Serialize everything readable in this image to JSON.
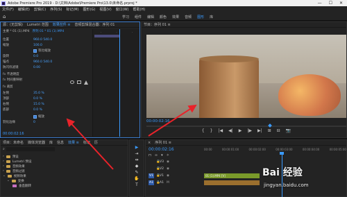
{
  "window": {
    "title": "Adobe Premiere Pro 2019 - D:\\文档\\Adobe\\Premiere Pro\\13.0\\未命名.prproj *",
    "minimize": "—",
    "maximize": "☐",
    "close": "✕"
  },
  "menu": [
    "文件(F)",
    "编辑(E)",
    "剪辑(C)",
    "序列(S)",
    "标记(M)",
    "图形(G)",
    "视图(V)",
    "窗口(W)",
    "帮助(H)"
  ],
  "workspaces": {
    "home_icon": "home-icon",
    "tabs": [
      {
        "label": "学习",
        "active": false
      },
      {
        "label": "组件",
        "active": false
      },
      {
        "label": "编辑",
        "active": false
      },
      {
        "label": "颜色",
        "active": false
      },
      {
        "label": "效果",
        "active": false
      },
      {
        "label": "音频",
        "active": false
      },
      {
        "label": "图形",
        "active": true
      },
      {
        "label": "库",
        "active": false
      }
    ]
  },
  "effect_controls": {
    "tabs": [
      "源：(无剪辑)",
      "Lumetri 范围",
      "效果控件 ≡",
      "音频剪辑混合器：序列 01"
    ],
    "source": "主要 * 01 (1).MP4",
    "sequence": "序列 01 * 01 (1).MP4",
    "rows": [
      {
        "label": "位置",
        "value": "960.0  540.0"
      },
      {
        "label": "缩放",
        "value": "100.0"
      },
      {
        "label": "",
        "value": "等比缩放"
      },
      {
        "label": "旋转",
        "value": "0.0"
      },
      {
        "label": "锚点",
        "value": "960.0  540.0"
      },
      {
        "label": "防闪烁滤镜",
        "value": "0.00"
      },
      {
        "label": "不透明度",
        "value": ""
      },
      {
        "label": "时间重映射",
        "value": ""
      },
      {
        "label": "裁剪",
        "value": ""
      },
      {
        "label": "左侧",
        "value": "35.0 %"
      },
      {
        "label": "顶部",
        "value": "0.0 %"
      },
      {
        "label": "右侧",
        "value": "15.0 %"
      },
      {
        "label": "底部",
        "value": "0.0 %"
      },
      {
        "label": "",
        "value": "缩放"
      },
      {
        "label": "羽化边缘",
        "value": "0"
      }
    ],
    "timecode": "00:00:02:16"
  },
  "program": {
    "tab": "节目：序列 01 ≡",
    "timecode": "00:00:02:16",
    "controls": [
      "{",
      "}",
      "|◀",
      "◀|",
      "▶",
      "|▶",
      "▶|",
      "⊞",
      "⊟",
      "📷"
    ]
  },
  "project": {
    "tabs": [
      "项目：未命名",
      "媒体浏览器",
      "库",
      "信息",
      "效果 ≡",
      "标记",
      "历"
    ],
    "search_placeholder": "",
    "items": [
      {
        "label": "预设",
        "kind": "folder"
      },
      {
        "label": "Lumetri 预设",
        "kind": "folder"
      },
      {
        "label": "音频效果",
        "kind": "folder"
      },
      {
        "label": "音频过渡",
        "kind": "folder"
      },
      {
        "label": "视频效果",
        "kind": "folder"
      },
      {
        "label": "变换",
        "kind": "folder"
      },
      {
        "label": "垂直翻转",
        "kind": "effect"
      }
    ]
  },
  "timeline": {
    "tab": "序列 01 ≡",
    "timecode": "00:00:02:16",
    "ruler": [
      "00:00",
      "00:00:01:00",
      "00:00:02:00",
      "00:00:03:00",
      "00:00:04:00",
      "00:00:05:00"
    ],
    "tracks": [
      {
        "source": "",
        "name": "V3"
      },
      {
        "source": "",
        "name": "V2"
      },
      {
        "source": "V1",
        "name": "V1",
        "clip": "01 (1).MP4 [V]"
      },
      {
        "source": "A1",
        "name": "A1"
      }
    ]
  },
  "tools": [
    "▶",
    "⇥",
    "⇹",
    "◆",
    "✎",
    "✋",
    "T"
  ],
  "watermark": {
    "logo": "Bai 经验",
    "url": "jingyan.baidu.com"
  }
}
